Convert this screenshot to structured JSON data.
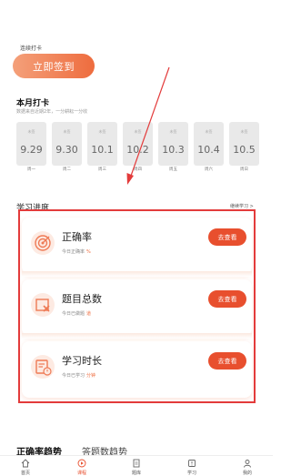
{
  "checkin": {
    "streak_label": "连续打卡",
    "button_label": "立即签到"
  },
  "month": {
    "title": "本月打卡",
    "subtitle": "数据来自近期2年，一分耕耘一分收",
    "days": [
      {
        "tag": "未签",
        "date": "9.29",
        "week": "周一"
      },
      {
        "tag": "未签",
        "date": "9.30",
        "week": "周二"
      },
      {
        "tag": "未签",
        "date": "10.1",
        "week": "周三"
      },
      {
        "tag": "未签",
        "date": "10.2",
        "week": "周四"
      },
      {
        "tag": "未签",
        "date": "10.3",
        "week": "周五"
      },
      {
        "tag": "未签",
        "date": "10.4",
        "week": "周六"
      },
      {
        "tag": "未签",
        "date": "10.5",
        "week": "周日"
      }
    ]
  },
  "progress": {
    "title": "学习进度",
    "more_label": "继续学习 >",
    "cards": [
      {
        "title": "正确率",
        "sub_label": "今日正确率",
        "sub_value": "%",
        "button": "去查看",
        "icon": "target-icon"
      },
      {
        "title": "题目总数",
        "sub_label": "今日已做题",
        "sub_value": "道",
        "button": "去查看",
        "icon": "question-count-icon"
      },
      {
        "title": "学习时长",
        "sub_label": "今日已学习",
        "sub_value": "分钟",
        "button": "去查看",
        "icon": "study-time-icon"
      }
    ]
  },
  "trend": {
    "tab_active": "正确率趋势",
    "tab_inactive": "答题数趋势"
  },
  "nav": {
    "items": [
      {
        "label": "首页",
        "icon": "home-icon"
      },
      {
        "label": "课程",
        "icon": "course-icon"
      },
      {
        "label": "题库",
        "icon": "question-bank-icon"
      },
      {
        "label": "学习",
        "icon": "study-icon"
      },
      {
        "label": "我的",
        "icon": "profile-icon"
      }
    ]
  },
  "colors": {
    "accent": "#e84f2e",
    "annotation": "#e33b3b",
    "card_inactive": "#e9e9e9"
  }
}
